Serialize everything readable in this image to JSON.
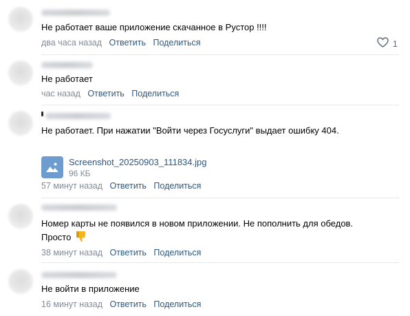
{
  "comments": [
    {
      "text": "Не работает ваше приложение скачанное в Рустор !!!!",
      "time": "два часа назад",
      "reply": "Ответить",
      "share": "Поделиться",
      "likes": "1"
    },
    {
      "text": "Не работает",
      "time": "час назад",
      "reply": "Ответить",
      "share": "Поделиться"
    },
    {
      "text": "Не работает. При нажатии \"Войти через Госуслуги\" выдает ошибку 404.",
      "attachment": {
        "name": "Screenshot_20250903_111834.jpg",
        "size": "96 КБ",
        "icon": "image-file-icon"
      },
      "time": "57 минут назад",
      "reply": "Ответить",
      "share": "Поделиться"
    },
    {
      "text_line1": "Номер карты не появился в новом приложении. Не пополнить для обедов.",
      "text_line2": "Просто",
      "emoji": "thumbs-down-icon",
      "time": "38 минут назад",
      "reply": "Ответить",
      "share": "Поделиться"
    },
    {
      "text": "Не войти в приложение",
      "time": "16 минут назад",
      "reply": "Ответить",
      "share": "Поделиться"
    }
  ],
  "colors": {
    "link": "#2a5885",
    "meta": "#818c99",
    "divider": "#e7e8ec",
    "file_thumb": "#6e9ccf",
    "emoji": "#f2b51e"
  }
}
